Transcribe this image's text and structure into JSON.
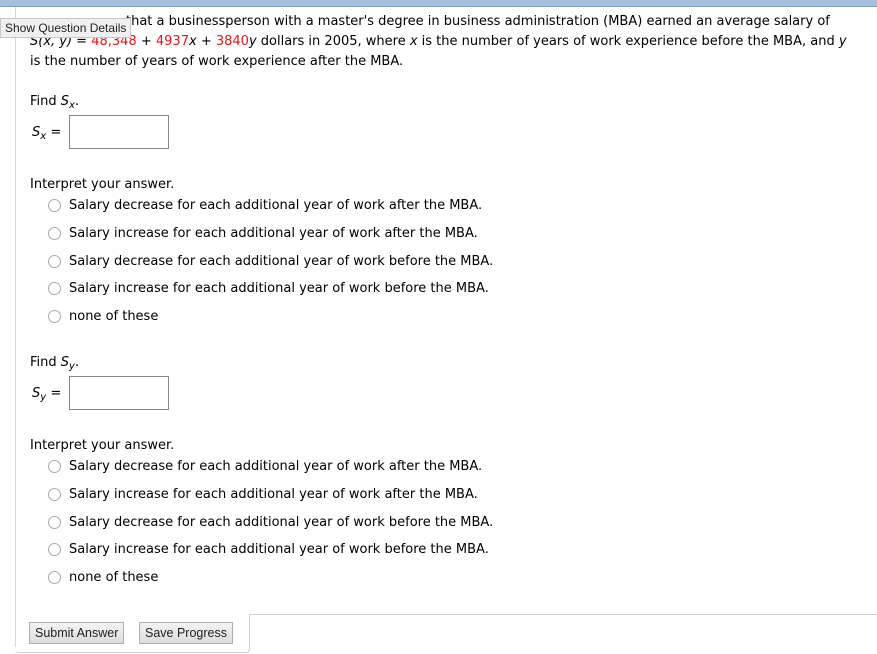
{
  "tooltip": "Show Question Details",
  "question": {
    "line1_visible": "that a businessperson with a master's degree in business administration (MBA) earned an average salary of",
    "formula_lhs": "S(x, y) = ",
    "const": "48,348",
    "plus1": " + ",
    "coef_x": "4937",
    "var_x": "x",
    "plus2": " + ",
    "coef_y": "3840",
    "var_y": "y",
    "rest2": " dollars  in 2005, where ",
    "x": "x",
    "rest3": " is the number of years of work experience before the MBA, and ",
    "y": "y",
    "line3": "is the number of years of work experience after the MBA."
  },
  "part1": {
    "find_label": "Find ",
    "symbol": "S",
    "subscript": "x",
    "answer_label_eq": " =",
    "answer_value": "",
    "interpret_label": "Interpret your answer.",
    "options": [
      "Salary decrease for each additional year of work after the MBA.",
      "Salary increase for each additional year of work after the MBA.",
      "Salary decrease for each additional year of work before the MBA.",
      "Salary increase for each additional year of work before the MBA.",
      "none of these"
    ]
  },
  "part2": {
    "find_label": "Find ",
    "symbol": "S",
    "subscript": "y",
    "answer_label_eq": " =",
    "answer_value": "",
    "interpret_label": "Interpret your answer.",
    "options": [
      "Salary decrease for each additional year of work after the MBA.",
      "Salary increase for each additional year of work after the MBA.",
      "Salary decrease for each additional year of work before the MBA.",
      "Salary increase for each additional year of work before the MBA.",
      "none of these"
    ]
  },
  "buttons": {
    "submit": "Submit Answer",
    "save": "Save Progress"
  }
}
